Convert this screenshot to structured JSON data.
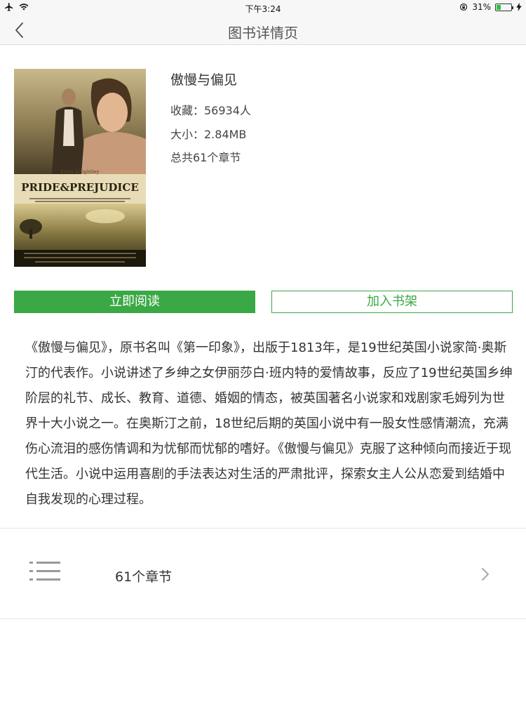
{
  "status_bar": {
    "time": "下午3:24",
    "battery_text": "31%",
    "battery_level": 0.31,
    "icons": [
      "airplane-icon",
      "wifi-icon",
      "rotation-lock-icon",
      "battery-icon",
      "charging-icon"
    ]
  },
  "nav": {
    "title": "图书详情页",
    "back_icon": "back-chevron-icon"
  },
  "book": {
    "title": "傲慢与偏见",
    "favorites": "收藏：56934人",
    "size": "大小：2.84MB",
    "chapters_total": "总共61个章节",
    "cover": {
      "actor": "Keira Knightley",
      "title_text": "PRIDE&PREJUDICE"
    }
  },
  "actions": {
    "read_label": "立即阅读",
    "shelf_label": "加入书架"
  },
  "description": "《傲慢与偏见》，原书名叫《第一印象》，出版于1813年，是19世纪英国小说家简·奥斯汀的代表作。小说讲述了乡绅之女伊丽莎白·班内特的爱情故事，反应了19世纪英国乡绅阶层的礼节、成长、教育、道德、婚姻的情态，被英国著名小说家和戏剧家毛姆列为世界十大小说之一。在奥斯汀之前，18世纪后期的英国小说中有一股女性感情潮流，充满伤心流泪的感伤情调和为忧郁而忧郁的嗜好。《傲慢与偏见》克服了这种倾向而接近于现代生活。小说中运用喜剧的手法表达对生活的严肃批评，探索女主人公从恋爱到结婚中自我发现的心理过程。",
  "chapters_row": {
    "label": "61个章节",
    "icon": "list-icon",
    "arrow_icon": "chevron-right-icon"
  },
  "colors": {
    "accent": "#3aa845",
    "nav_bg": "#f7f7f7"
  }
}
